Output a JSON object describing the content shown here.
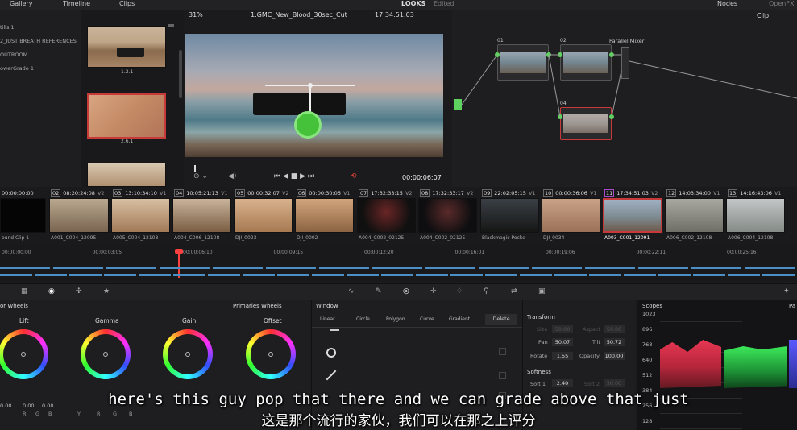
{
  "topbar": {
    "gallery": "Gallery",
    "timeline": "Timeline",
    "clips": "Clips",
    "page_title": "LOOKS",
    "edited": "Edited",
    "nodes": "Nodes",
    "openfx": "OpenFX"
  },
  "stills": {
    "items": [
      "tills 1",
      "2_JUST BREATH REFERENCES",
      "OUTROOM",
      "owerGrade 1"
    ],
    "thumb_labels": [
      "1.2.1",
      "2.6.1"
    ]
  },
  "viewer": {
    "zoom": "31%",
    "clip_name": "1.GMC_New_Blood_30sec_Cut",
    "timecode_top": "17:34:51:03",
    "timecode_bottom": "00:00:06:07"
  },
  "node_editor": {
    "mode": "Clip",
    "labels": [
      "01",
      "02",
      "04"
    ],
    "parallel_mixer": "Parallel Mixer"
  },
  "timeline_clips": [
    {
      "num": "",
      "tc": "00:00:00:00",
      "track": "",
      "label": "ound Clip 1"
    },
    {
      "num": "02",
      "tc": "08:20:24:08",
      "track": "V2",
      "label": "A001_C004_12095"
    },
    {
      "num": "03",
      "tc": "13:10:34:10",
      "track": "V1",
      "label": "A005_C004_12108"
    },
    {
      "num": "04",
      "tc": "10:05:21:13",
      "track": "V1",
      "label": "A004_C006_12108"
    },
    {
      "num": "05",
      "tc": "00:00:32:07",
      "track": "V2",
      "label": "DJI_0023"
    },
    {
      "num": "06",
      "tc": "00:00:30:06",
      "track": "V1",
      "label": "DJI_0002"
    },
    {
      "num": "07",
      "tc": "17:32:33:15",
      "track": "V2",
      "label": "A004_C002_02125"
    },
    {
      "num": "08",
      "tc": "17:32:33:17",
      "track": "V2",
      "label": "A004_C002_02125"
    },
    {
      "num": "09",
      "tc": "22:02:05:15",
      "track": "V1",
      "label": "Blackmagic Pocke"
    },
    {
      "num": "10",
      "tc": "00:00:36:06",
      "track": "V1",
      "label": "DJI_0034"
    },
    {
      "num": "11",
      "tc": "17:34:51:03",
      "track": "V2",
      "label": "A003_C001_12091"
    },
    {
      "num": "12",
      "tc": "14:03:34:00",
      "track": "V1",
      "label": "A006_C002_12108"
    },
    {
      "num": "13",
      "tc": "14:16:43:06",
      "track": "V1",
      "label": "A006_C004_12108"
    }
  ],
  "ruler": [
    "00:00:00:00",
    "00:00:03:05",
    "00:00:06:10",
    "00:00:09:15",
    "00:00:12:20",
    "00:00:16:01",
    "00:00:19:06",
    "00:00:22:11",
    "00:00:25:16"
  ],
  "color_wheels": {
    "title": "or Wheels",
    "mode": "Primaries Wheels",
    "wheels": [
      "Lift",
      "Gamma",
      "Gain",
      "Offset"
    ],
    "values": [
      "0.00",
      "0.00",
      "0.00",
      "0.00"
    ],
    "channels": [
      "R",
      "G",
      "B"
    ],
    "gamma_channels": [
      "Y",
      "R",
      "G",
      "B"
    ]
  },
  "window": {
    "title": "Window",
    "tools": [
      "Linear",
      "Circle",
      "Polygon",
      "Curve",
      "Gradient"
    ],
    "delete": "Delete"
  },
  "transform": {
    "title": "Transform",
    "fields": [
      {
        "label": "Size",
        "value": "50.00"
      },
      {
        "label": "Aspect",
        "value": "50.00"
      },
      {
        "label": "Pan",
        "value": "50.07"
      },
      {
        "label": "Tilt",
        "value": "50.72"
      },
      {
        "label": "Rotate",
        "value": "1.55"
      },
      {
        "label": "Opacity",
        "value": "100.00"
      }
    ],
    "softness_title": "Softness",
    "soft": [
      {
        "label": "Soft 1",
        "value": "2.40"
      },
      {
        "label": "Soft 2",
        "value": "50.00"
      }
    ]
  },
  "scopes": {
    "title": "Scopes",
    "mode": "Pa",
    "scale": [
      "1023",
      "896",
      "768",
      "640",
      "512",
      "384",
      "256",
      "128"
    ]
  },
  "subtitles": {
    "english": "here's this guy pop that there and we can grade above that just",
    "chinese": "这是那个流行的家伙，我们可以在那之上评分"
  },
  "colors": {
    "accent_red": "#e0403a",
    "node_green": "#5fd35f",
    "playhead": "#ff4040",
    "selected_clip": "#a84cc8"
  }
}
